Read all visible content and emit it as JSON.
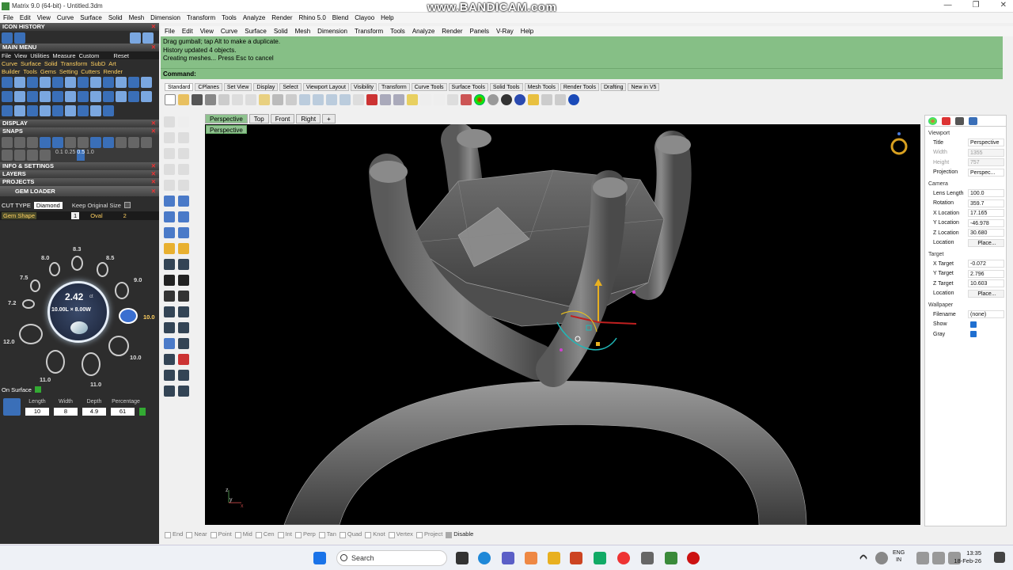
{
  "window": {
    "title": "Matrix 9.0 (64-bit) - Untitled.3dm",
    "watermark": "www.BANDICAM.com",
    "buttons": [
      "—",
      "❐",
      "✕"
    ]
  },
  "app_menu": [
    "File",
    "Edit",
    "View",
    "Curve",
    "Surface",
    "Solid",
    "Mesh",
    "Dimension",
    "Transform",
    "Tools",
    "Analyze",
    "Render",
    "Rhino 5.0",
    "Blend",
    "Clayoo",
    "Help"
  ],
  "rhino_menu": [
    "File",
    "Edit",
    "View",
    "Curve",
    "Surface",
    "Solid",
    "Mesh",
    "Dimension",
    "Transform",
    "Tools",
    "Analyze",
    "Render",
    "Panels",
    "V-Ray",
    "Help"
  ],
  "left_panel": {
    "icon_history": "ICON HISTORY",
    "main_menu": "MAIN MENU",
    "main_menu_row": [
      "File",
      "View",
      "Utilities",
      "Measure",
      "Custom",
      "Reset"
    ],
    "cat_row1": [
      "Curve",
      "Surface",
      "Solid",
      "Transform",
      "SubD",
      "Art"
    ],
    "cat_row2": [
      "Builder",
      "Tools",
      "Gems",
      "Setting",
      "Cutters",
      "Render"
    ],
    "display": "DISPLAY",
    "snaps": "SNAPS",
    "snap_values": [
      "0.1",
      "0.25",
      "0.5",
      "1.0"
    ],
    "info_settings": "INFO & SETTINGS",
    "layers": "LAYERS",
    "projects": "PROJECTS",
    "gem_loader": "GEM LOADER",
    "cut_type_label": "CUT TYPE",
    "cut_type_value": "Diamond",
    "keep_size": "Keep Original Size",
    "gem_shape_label": "Gem Shape",
    "gem_shape_num": "1",
    "gem_shape_value": "Oval",
    "gem_shape_num2": "2",
    "carat": "2.42",
    "carat_unit": "ct",
    "dims": "10.00L × 8.00W",
    "size_labels": [
      "8.3",
      "8.0",
      "8.5",
      "7.5",
      "9.0",
      "7.2",
      "10.0",
      "12.0",
      "10.0",
      "11.0",
      "11.0"
    ],
    "on_surface": "On Surface",
    "param_headers": [
      "Length",
      "Width",
      "Depth",
      "Percentage"
    ],
    "param_values": [
      "10",
      "8",
      "4.9",
      "61"
    ]
  },
  "command": {
    "history": [
      "Drag gumball; tap Alt to make a duplicate.",
      "History updated 4 objects.",
      "Creating meshes... Press Esc to cancel"
    ],
    "prompt": "Command:"
  },
  "toolbar_tabs": [
    "Standard",
    "CPlanes",
    "Set View",
    "Display",
    "Select",
    "Viewport Layout",
    "Visibility",
    "Transform",
    "Curve Tools",
    "Surface Tools",
    "Solid Tools",
    "Mesh Tools",
    "Render Tools",
    "Drafting",
    "New in V5"
  ],
  "viewport": {
    "tabs": [
      "Perspective",
      "Top",
      "Front",
      "Right"
    ],
    "add_tab": "+",
    "label": "Perspective"
  },
  "properties": {
    "viewport_title": "Viewport",
    "rows": [
      {
        "k": "Title",
        "v": "Perspective"
      },
      {
        "k": "Width",
        "v": "1355",
        "dim": true
      },
      {
        "k": "Height",
        "v": "757",
        "dim": true
      },
      {
        "k": "Projection",
        "v": "Perspec..."
      }
    ],
    "camera_title": "Camera",
    "camera": [
      {
        "k": "Lens Length",
        "v": "100.0"
      },
      {
        "k": "Rotation",
        "v": "359.7"
      },
      {
        "k": "X Location",
        "v": "17.165"
      },
      {
        "k": "Y Location",
        "v": "-46.978"
      },
      {
        "k": "Z Location",
        "v": "30.680"
      },
      {
        "k": "Location",
        "v": "Place..."
      }
    ],
    "target_title": "Target",
    "target": [
      {
        "k": "X Target",
        "v": "-0.072"
      },
      {
        "k": "Y Target",
        "v": "2.796"
      },
      {
        "k": "Z Target",
        "v": "10.603"
      },
      {
        "k": "Location",
        "v": "Place..."
      }
    ],
    "wallpaper_title": "Wallpaper",
    "filename_label": "Filename",
    "filename_value": "(none)",
    "show_label": "Show",
    "gray_label": "Gray"
  },
  "osnaps": [
    "End",
    "Near",
    "Point",
    "Mid",
    "Cen",
    "Int",
    "Perp",
    "Tan",
    "Quad",
    "Knot",
    "Vertex",
    "Project",
    "Disable"
  ],
  "taskbar": {
    "search": "Search",
    "lang1": "ENG",
    "lang2": "IN",
    "time": "13:35",
    "date": "18-Feb-26"
  },
  "colors": {
    "command_bg": "#86bf86",
    "viewport_bg": "#000000",
    "panel_bg": "#2d2d2d"
  }
}
